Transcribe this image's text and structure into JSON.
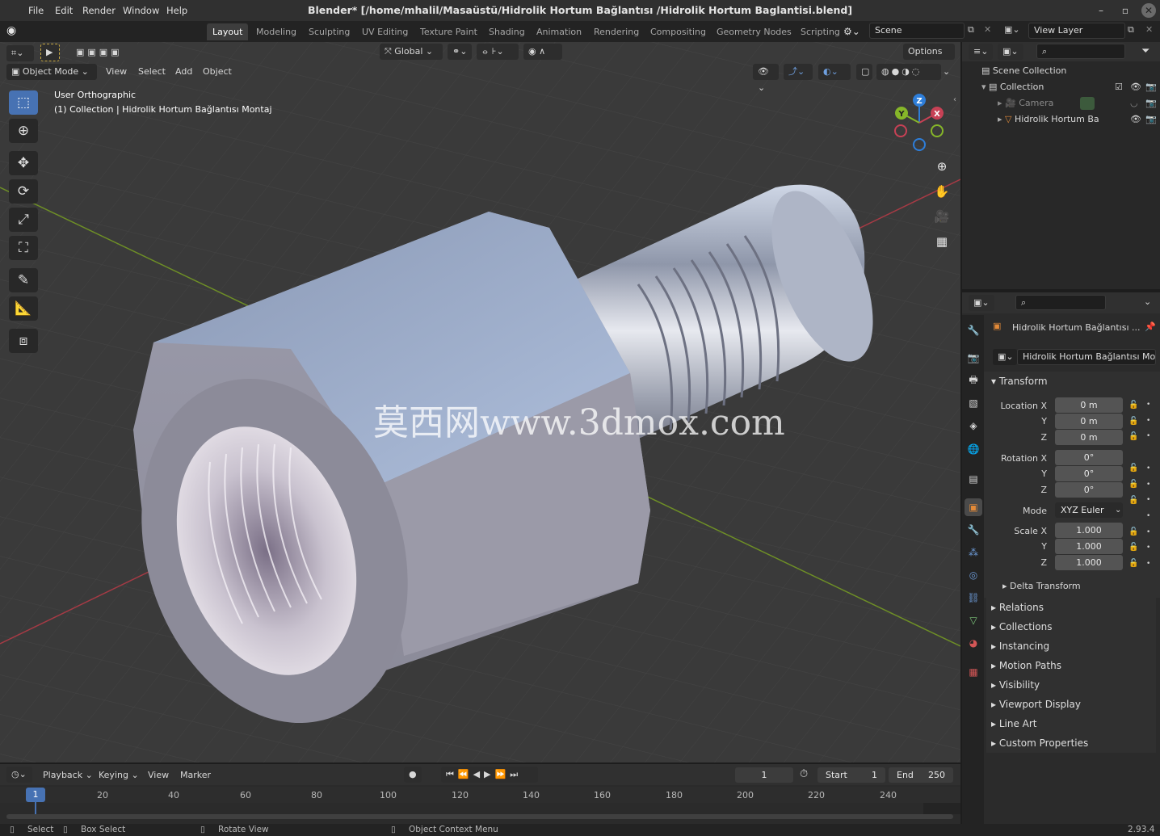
{
  "window": {
    "title": "Blender* [/home/mhalil/Masaüstü/Hidrolik Hortum Bağlantısı /Hidrolik Hortum Baglantisi.blend]"
  },
  "menu": [
    "File",
    "Edit",
    "Render",
    "Window",
    "Help"
  ],
  "workspaces": [
    "Layout",
    "Modeling",
    "Sculpting",
    "UV Editing",
    "Texture Paint",
    "Shading",
    "Animation",
    "Rendering",
    "Compositing",
    "Geometry Nodes",
    "Scripting"
  ],
  "active_workspace": "Layout",
  "scene": {
    "name": "Scene",
    "view_layer": "View Layer"
  },
  "viewport": {
    "transform_orientation": "Global",
    "options_label": "Options",
    "mode": "Object Mode",
    "header_menus": [
      "View",
      "Select",
      "Add",
      "Object"
    ],
    "overlay_line1": "User Orthographic",
    "overlay_line2": "(1) Collection | Hidrolik Hortum Bağlantısı Montaj",
    "watermark": "莫西网www.3dmox.com",
    "gizmo_axes": {
      "z": "Z",
      "y": "Y",
      "x": "X"
    },
    "colors": {
      "x_axis": "#c74155",
      "y_axis": "#86b629",
      "z_axis": "#2e7ed9",
      "active": "#4772b3"
    }
  },
  "tools": [
    "select-box-icon",
    "cursor-icon",
    "move-icon",
    "rotate-icon",
    "scale-icon",
    "transform-icon",
    "annotate-icon",
    "measure-icon",
    "add-cube-icon"
  ],
  "outliner": {
    "rows": [
      {
        "label": "Scene Collection"
      },
      {
        "label": "Collection"
      },
      {
        "label": "Camera"
      },
      {
        "label": "Hidrolik Hortum Ba"
      }
    ]
  },
  "properties": {
    "object_name": "Hidrolik Hortum Bağlantısı ...",
    "data_name": "Hidrolik Hortum Bağlantısı Mo...",
    "transform_header": "Transform",
    "location": {
      "label": "Location X",
      "x": "0 m",
      "y": "0 m",
      "z": "0 m"
    },
    "rotation": {
      "label": "Rotation X",
      "x": "0°",
      "y": "0°",
      "z": "0°"
    },
    "mode": {
      "label": "Mode",
      "value": "XYZ Euler"
    },
    "scale": {
      "label": "Scale X",
      "x": "1.000",
      "y": "1.000",
      "z": "1.000"
    },
    "axis_labels": {
      "y": "Y",
      "z": "Z"
    },
    "delta_transform": "Delta Transform",
    "sections": [
      "Relations",
      "Collections",
      "Instancing",
      "Motion Paths",
      "Visibility",
      "Viewport Display",
      "Line Art",
      "Custom Properties"
    ]
  },
  "timeline": {
    "menus": [
      "Playback",
      "Keying",
      "View",
      "Marker"
    ],
    "current_frame": "1",
    "start_label": "Start",
    "start": "1",
    "end_label": "End",
    "end": "250",
    "ruler": [
      "20",
      "40",
      "60",
      "80",
      "100",
      "120",
      "140",
      "160",
      "180",
      "200",
      "220",
      "240"
    ],
    "playhead": "1"
  },
  "statusbar": {
    "select": "Select",
    "box_select": "Box Select",
    "rotate_view": "Rotate View",
    "context_menu": "Object Context Menu",
    "version": "2.93.4"
  }
}
